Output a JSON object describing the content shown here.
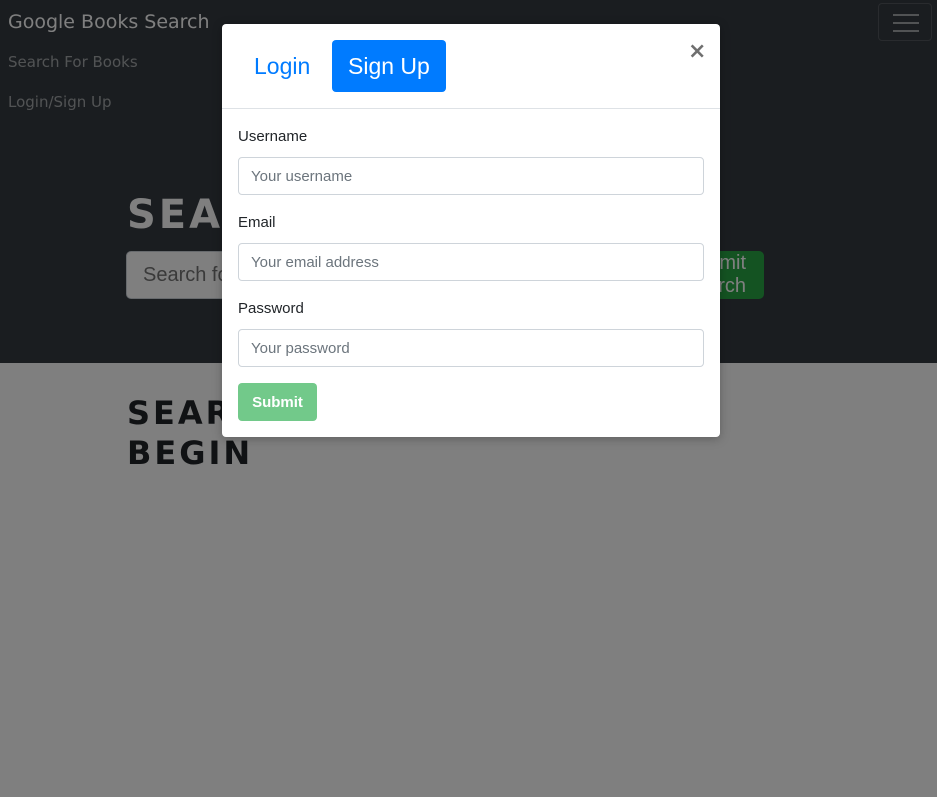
{
  "navbar": {
    "brand": "Google Books Search",
    "links": [
      "Search For Books",
      "Login/Sign Up"
    ],
    "toggler_icon": "hamburger-icon"
  },
  "hero": {
    "title": "SEARCH FOR BOOKS!",
    "search_placeholder": "Search for a book",
    "search_button": "Submit Search"
  },
  "results": {
    "heading": "SEARCH FOR A BOOK TO BEGIN"
  },
  "modal": {
    "tabs": [
      "Login",
      "Sign Up"
    ],
    "active_tab": "Sign Up",
    "close_label": "×",
    "fields": [
      {
        "label": "Username",
        "placeholder": "Your username",
        "value": ""
      },
      {
        "label": "Email",
        "placeholder": "Your email address",
        "value": ""
      },
      {
        "label": "Password",
        "placeholder": "Your password",
        "value": ""
      }
    ],
    "submit_label": "Submit"
  },
  "colors": {
    "navbar_bg": "#343a40",
    "primary": "#007bff",
    "success": "#28a745",
    "submit_disabled": "#72c98a"
  }
}
